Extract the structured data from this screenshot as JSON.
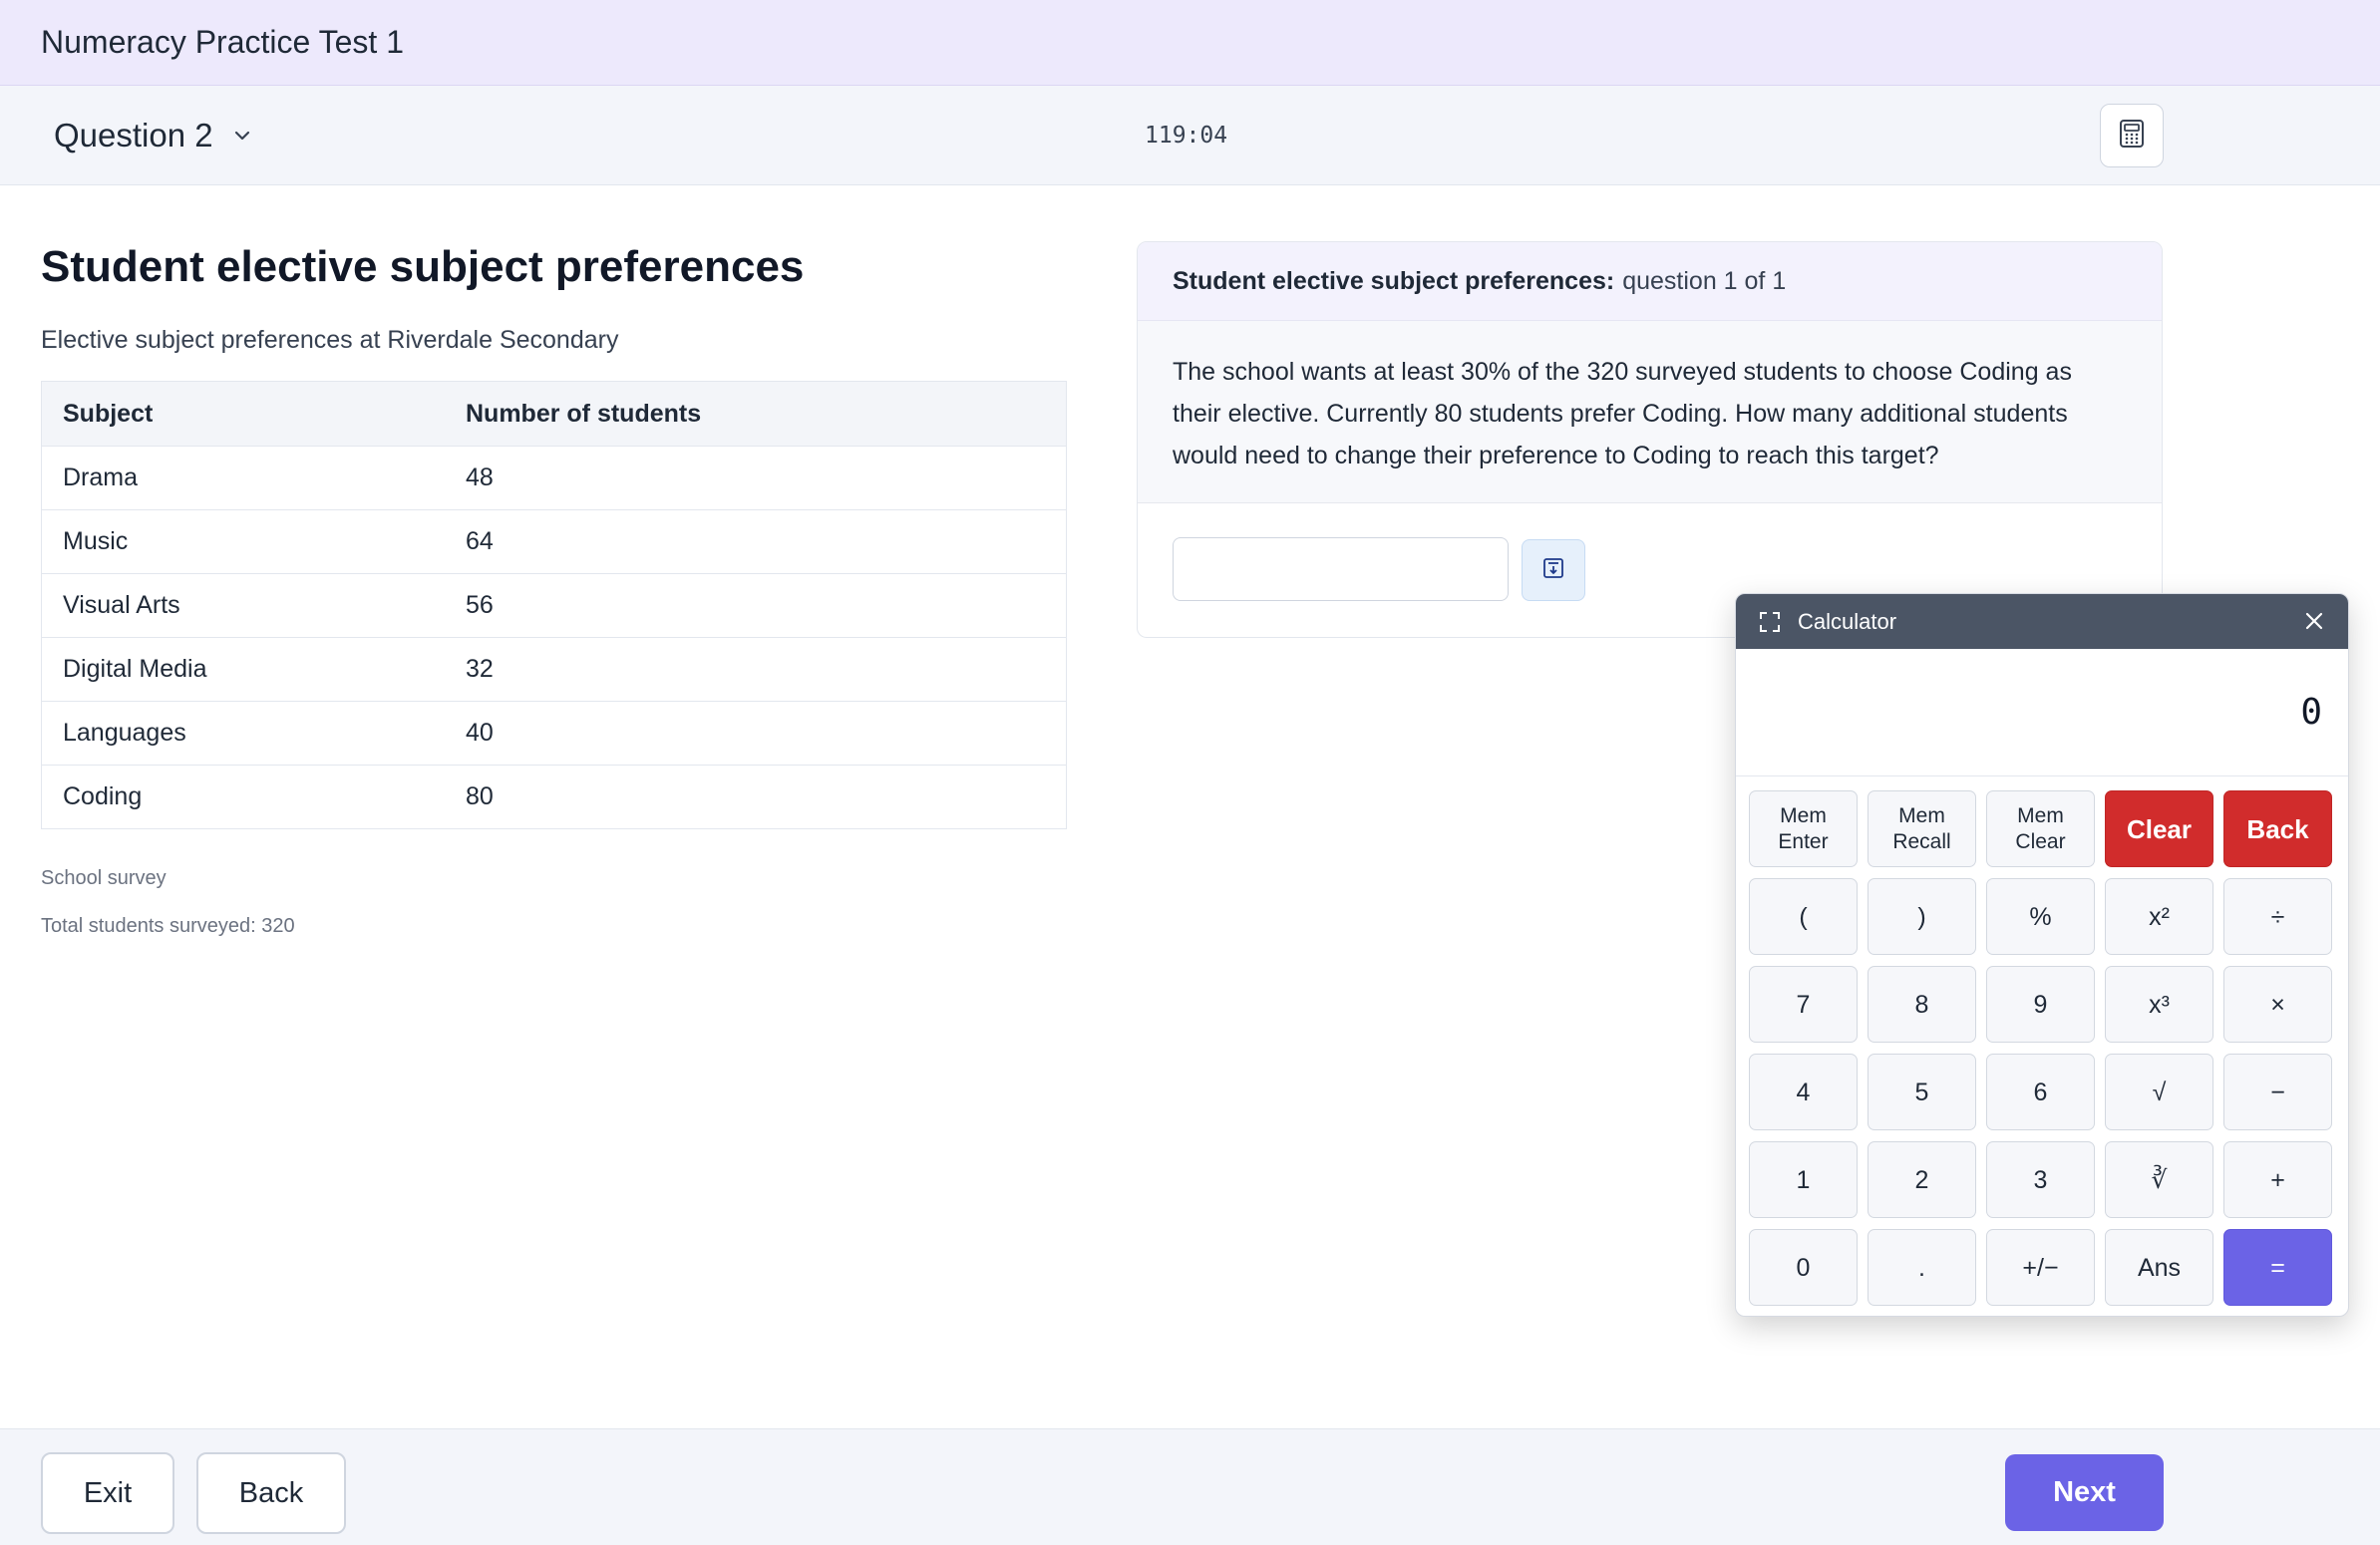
{
  "app": {
    "title": "Numeracy Practice Test 1"
  },
  "question_bar": {
    "question_label": "Question 2",
    "timer": "119:04"
  },
  "stimulus": {
    "heading": "Student elective subject preferences",
    "subheading": "Elective subject preferences at Riverdale Secondary",
    "table": {
      "headers": [
        "Subject",
        "Number of students"
      ],
      "rows": [
        [
          "Drama",
          "48"
        ],
        [
          "Music",
          "64"
        ],
        [
          "Visual Arts",
          "56"
        ],
        [
          "Digital Media",
          "32"
        ],
        [
          "Languages",
          "40"
        ],
        [
          "Coding",
          "80"
        ]
      ]
    },
    "source": "School survey",
    "total": "Total students surveyed: 320"
  },
  "question": {
    "header_bold": "Student elective subject preferences:",
    "header_rest": "question 1 of 1",
    "text": "The school wants at least 30% of the 320 surveyed students to choose Coding as their elective. Currently 80 students prefer Coding. How many additional students would need to change their preference to Coding to reach this target?",
    "answer_value": "",
    "answer_placeholder": ""
  },
  "calculator": {
    "title": "Calculator",
    "display": "0",
    "keys": [
      "Mem\nEnter",
      "Mem\nRecall",
      "Mem\nClear",
      "Clear",
      "Back",
      "(",
      ")",
      "%",
      "x²",
      "÷",
      "7",
      "8",
      "9",
      "x³",
      "×",
      "4",
      "5",
      "6",
      "√",
      "−",
      "1",
      "2",
      "3",
      "∛",
      "+",
      "0",
      ".",
      "+/−",
      "Ans",
      "="
    ]
  },
  "footer": {
    "exit_label": "Exit",
    "back_label": "Back",
    "next_label": "Next"
  },
  "colors": {
    "accent": "#6b63e6",
    "danger": "#d12c2c",
    "titlebar_bg": "#ede9fc",
    "calc_header_bg": "#4b5565"
  },
  "icons": [
    "chevron-down-icon",
    "calculator-icon",
    "insert-answer-icon",
    "expand-icon",
    "close-icon"
  ]
}
